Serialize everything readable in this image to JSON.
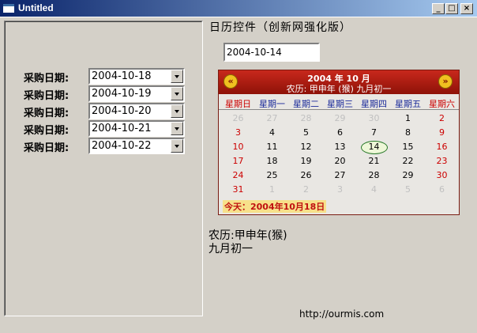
{
  "window": {
    "title": "Untitled",
    "minimize": "_",
    "maximize": "□",
    "close": "×"
  },
  "form": {
    "rows": [
      {
        "label": "采购日期:",
        "value": "2004-10-18"
      },
      {
        "label": "采购日期:",
        "value": "2004-10-19"
      },
      {
        "label": "采购日期:",
        "value": "2004-10-20"
      },
      {
        "label": "采购日期:",
        "value": "2004-10-21"
      },
      {
        "label": "采购日期:",
        "value": "2004-10-22"
      }
    ]
  },
  "calendar": {
    "title": "日历控件（创新网强化版）",
    "input_value": "2004-10-14",
    "header_year_month": "2004 年  10  月",
    "header_lunar": "农历: 甲申年 (猴) 九月初一",
    "prev": "«",
    "next": "»",
    "weekdays": [
      "星期日",
      "星期一",
      "星期二",
      "星期三",
      "星期四",
      "星期五",
      "星期六"
    ],
    "weeks": [
      [
        "26",
        "27",
        "28",
        "29",
        "30",
        "1",
        "2"
      ],
      [
        "3",
        "4",
        "5",
        "6",
        "7",
        "8",
        "9"
      ],
      [
        "10",
        "11",
        "12",
        "13",
        "14",
        "15",
        "16"
      ],
      [
        "17",
        "18",
        "19",
        "20",
        "21",
        "22",
        "23"
      ],
      [
        "24",
        "25",
        "26",
        "27",
        "28",
        "29",
        "30"
      ],
      [
        "31",
        "1",
        "2",
        "3",
        "4",
        "5",
        "6"
      ]
    ],
    "selected_day": "14",
    "today_label": "今天：2004年10月18日",
    "colors": {
      "header": "#b01c10",
      "weekend": "#cc0000",
      "weekday_header": "#1a2a9a",
      "other_month": "#c0c0c0"
    }
  },
  "lunar_info": {
    "line1": "农历:甲申年(猴)",
    "line2": "九月初一"
  },
  "footer_url": "http://ourmis.com"
}
